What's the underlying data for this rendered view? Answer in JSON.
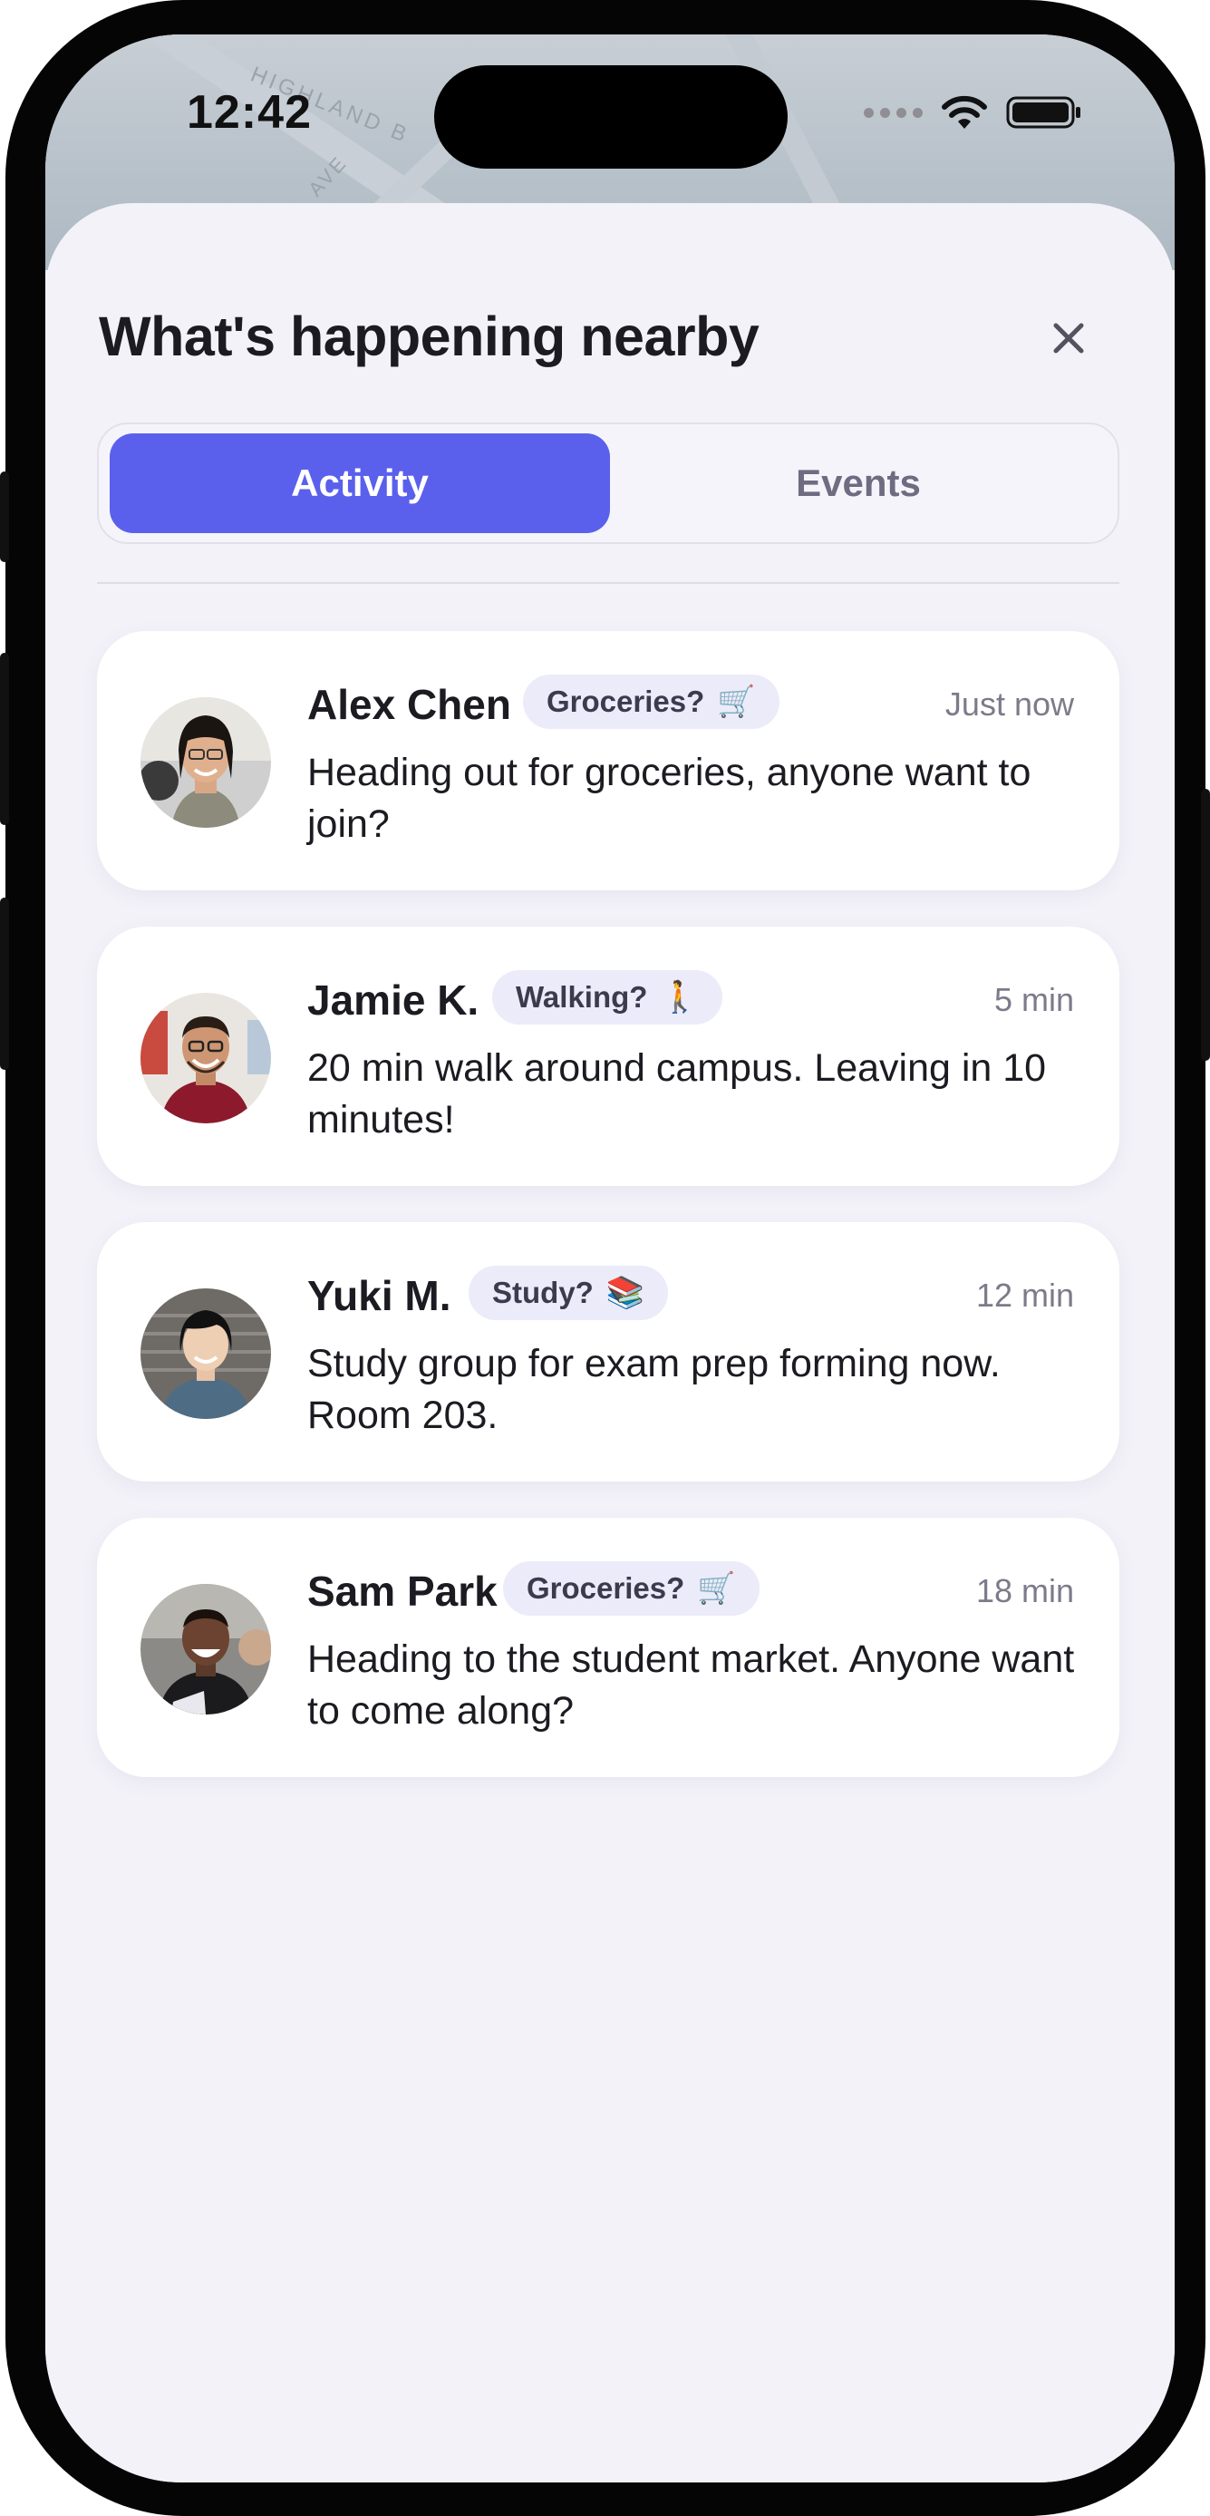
{
  "status_bar": {
    "time": "12:42"
  },
  "map_labels": {
    "street_1": "HIGHLAND B",
    "street_2": "AVE"
  },
  "sheet": {
    "title": "What's happening nearby",
    "close_icon": "close-icon"
  },
  "tabs": [
    {
      "label": "Activity",
      "selected": true
    },
    {
      "label": "Events",
      "selected": false
    }
  ],
  "feed": [
    {
      "name": "Alex Chen",
      "tag": "Groceries?",
      "tag_emoji": "🛒",
      "time": "Just now",
      "message": "Heading out for groceries, anyone want to join?"
    },
    {
      "name": "Jamie K.",
      "tag": "Walking?",
      "tag_emoji": "🚶",
      "time": "5 min",
      "message": "20 min walk around campus. Leaving in 10 minutes!"
    },
    {
      "name": "Yuki M.",
      "tag": "Study?",
      "tag_emoji": "📚",
      "time": "12 min",
      "message": "Study group for exam prep forming now. Room 203."
    },
    {
      "name": "Sam Park",
      "tag": "Groceries?",
      "tag_emoji": "🛒",
      "time": "18 min",
      "message": "Heading to the student market. Anyone want to come along?"
    }
  ],
  "colors": {
    "accent": "#5a60ec",
    "sheet_background": "#f3f2f9",
    "tag_background": "#ecebfa"
  }
}
